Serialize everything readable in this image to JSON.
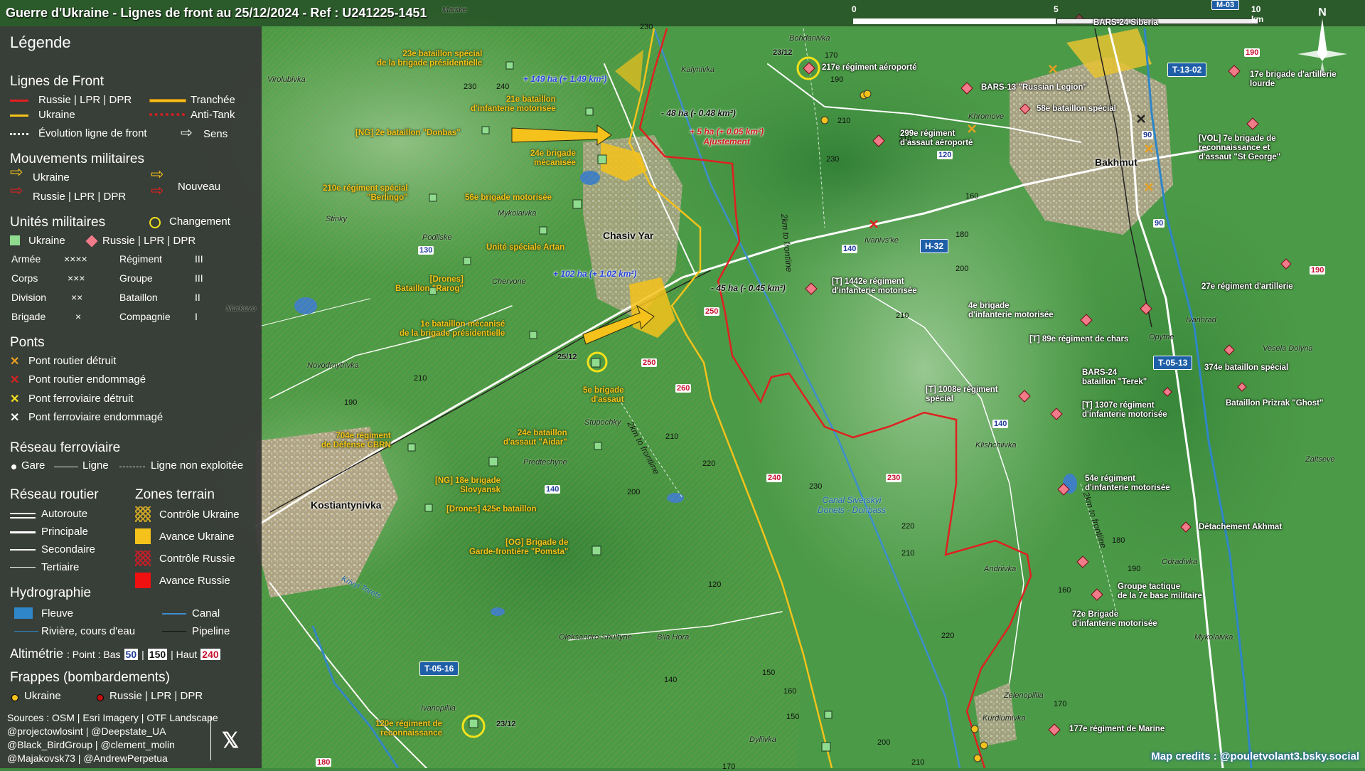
{
  "title": "Guerre d'Ukraine - Lignes de front au 25/12/2024 - Ref : U241225-1451",
  "scale": {
    "l0": "0",
    "l5": "5",
    "l10": "10 km"
  },
  "compass": "N",
  "credits": "Map credits : @pouletvolant3.bsky.social",
  "colors": {
    "russia": "#e02020",
    "ukraine": "#f4c21b",
    "water": "#2f86c8",
    "panel": "#373737"
  },
  "legend": {
    "title": "Légende",
    "front": {
      "title": "Lignes de Front",
      "russia": "Russie | LPR | DPR",
      "ukraine": "Ukraine",
      "evolution": "Évolution ligne de front",
      "trench": "Tranchée",
      "antitank": "Anti-Tank",
      "direction": "Sens"
    },
    "moves": {
      "title": "Mouvements militaires",
      "ukraine": "Ukraine",
      "russia": "Russie | LPR | DPR",
      "new": "Nouveau"
    },
    "units": {
      "title": "Unités militaires",
      "change": "Changement",
      "ukraine": "Ukraine",
      "russia": "Russie | LPR | DPR",
      "rows": [
        {
          "a": "Armée",
          "as": "××××",
          "b": "Régiment",
          "bs": "III"
        },
        {
          "a": "Corps",
          "as": "×××",
          "b": "Groupe",
          "bs": "III"
        },
        {
          "a": "Division",
          "as": "××",
          "b": "Bataillon",
          "bs": "II"
        },
        {
          "a": "Brigade",
          "as": "×",
          "b": "Compagnie",
          "bs": "I"
        }
      ]
    },
    "bridges": {
      "title": "Ponts",
      "items": [
        "Pont routier détruit",
        "Pont routier endommagé",
        "Pont ferroviaire détruit",
        "Pont ferroviaire endommagé"
      ]
    },
    "rail": {
      "title": "Réseau ferroviaire",
      "station": "Gare",
      "line": "Ligne",
      "unused": "Ligne non exploitée"
    },
    "roads": {
      "title": "Réseau routier",
      "items": [
        "Autoroute",
        "Principale",
        "Secondaire",
        "Tertiaire"
      ]
    },
    "terrain": {
      "title": "Zones terrain",
      "items": [
        "Contrôle Ukraine",
        "Avance Ukraine",
        "Contrôle Russie",
        "Avance Russie"
      ]
    },
    "hydro": {
      "title": "Hydrographie",
      "river": "Fleuve",
      "canal": "Canal",
      "stream": "Rivière, cours d'eau",
      "pipeline": "Pipeline"
    },
    "altitude": {
      "title": "Altimétrie",
      "prefix": ": Point : Bas",
      "low": "50",
      "sep1": "|",
      "mid": "150",
      "sep2": "| Haut",
      "high": "240"
    },
    "strikes": {
      "title": "Frappes (bombardements)",
      "ukraine": "Ukraine",
      "russia": "Russie | LPR | DPR"
    },
    "sources": [
      "Sources : OSM | Esri Imagery | OTF Landscape",
      "@projectowlosint | @Deepstate_UA",
      "@Black_BirdGroup | @clement_molin",
      "@Majakovsk73 | @AndrewPerpetua"
    ],
    "x_icon": "x-logo"
  },
  "cities": [
    "Chasiv Yar",
    "Kostiantynivka",
    "Bakhmut"
  ],
  "places": [
    "Maiske",
    "Bohdanivka",
    "Kalynivka",
    "Virolubivka",
    "Khromove",
    "Stinky",
    "Mykolaivka",
    "Podilske",
    "Chervone",
    "Markovo",
    "Novodmytrivka",
    "Ivanivs'ke",
    "Stupochky",
    "Predtechyne",
    "Klishchiivka",
    "Opytne",
    "Ivanhrad",
    "Vesela Dolyna",
    "Zaitseve",
    "Odradivka",
    "Andriivka",
    "Oleksandro-Shultyne",
    "Bila Hora",
    "Zelenopillia",
    "Kurdiumivka",
    "Dyliivka",
    "Ivanopillia",
    "Mykolaivka",
    "Krivyi Torets"
  ],
  "roads": [
    "T-13-02",
    "H-32",
    "T-05-13",
    "T-05-16",
    "M-03"
  ],
  "road_numbers": [
    "140",
    "130",
    "140",
    "90",
    "90",
    "120",
    "140"
  ],
  "altitudes": [
    "230",
    "240",
    "230",
    "210",
    "170",
    "190",
    "210",
    "230",
    "160",
    "180",
    "200",
    "210",
    "190",
    "210",
    "210",
    "220",
    "200",
    "120",
    "140",
    "150",
    "160",
    "180",
    "200",
    "230",
    "220",
    "210",
    "220",
    "190",
    "160",
    "170",
    "150",
    "170",
    "210"
  ],
  "altitudes_red": [
    "190",
    "250",
    "250",
    "260",
    "240",
    "230",
    "190",
    "180"
  ],
  "annotations": {
    "a1": "+ 149 ha (+ 1.49 km²)",
    "a2": "- 48 ha (- 0.48 km²)",
    "a3_1": "+ 5 ha (+ 0.05 km²)",
    "a3_2": "Ajustement",
    "a4": "+ 102 ha (+ 1.02 km²)",
    "a5": "- 45 ha (- 0.45 km²)"
  },
  "front_labels": [
    "2km to frontline",
    "2km to frontline",
    "2km to frontline"
  ],
  "canal_label": "Canal Siverskyi\nDonets - Donbass",
  "dates": [
    "23/12",
    "25/12",
    "23/12"
  ],
  "units_ua": [
    "23e bataillon spécial\nde la brigade présidentielle",
    "21e bataillon\nd'infanterie motorisée",
    "[NG] 2e bataillon \"Donbas\"",
    "24e brigade\nmécanisée",
    "210e régiment spécial\n\"Berlingo\"",
    "56e brigade motorisée",
    "Unité spéciale Artan",
    "[Drones]\nBataillon \"Rarog\"",
    "1e bataillon mécanisé\nde la brigade présidentielle",
    "5e brigade\nd'assaut",
    "704e régiment\nde Défense CBRN",
    "24e bataillon\nd'assaut \"Aidar\"",
    "[NG] 18e brigade\nSlovyansk",
    "[Drones] 425e bataillon",
    "[OG] Brigade de\nGarde-frontière \"Pomsta\"",
    "120e régiment de\nreconnaissance",
    "[VOL] 7e brigade de\nreconnaissance et\nd'assaut \"St George\""
  ],
  "units_ru": [
    "217e régiment aéroporté",
    "BARS-13 \"Russian Legion\"",
    "58e bataillon spécial",
    "BARS-24 Siberia",
    "299e régiment\nd'assaut aéroporté",
    "17e brigade d'artillerie\nlourde",
    "[T] 1442e régiment\nd'infanterie motorisée",
    "4e brigade\nd'infanterie motorisée",
    "27e régiment d'artillerie",
    "[T] 89e régiment de chars",
    "374e bataillon spécial",
    "BARS-24\nbataillon \"Terek\"",
    "Bataillon Prizrak \"Ghost\"",
    "[T] 1008e régiment\nspécial",
    "[T] 1307e régiment\nd'infanterie motorisée",
    "54e régiment\nd'infanterie motorisée",
    "Détachement Akhmat",
    "Groupe tactique\nde la 7e base militaire",
    "72e Brigade\nd'infanterie motorisée",
    "177e régiment de Marine"
  ]
}
